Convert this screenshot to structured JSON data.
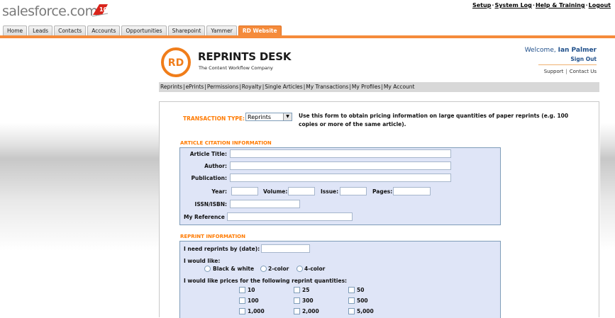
{
  "salesforce": {
    "logo_text": "salesforce.com",
    "logo_badge": "10",
    "top_links": [
      "Setup",
      "System Log",
      "Help & Training",
      "Logout"
    ],
    "tabs": [
      "Home",
      "Leads",
      "Contacts",
      "Accounts",
      "Opportunities",
      "Sharepoint",
      "Yammer",
      "RD Website"
    ],
    "active_tab": "RD Website",
    "accent_color": "#f58b3b"
  },
  "reprints_desk": {
    "logo_initials": "RD",
    "brand_name": "REPRINTS DESK",
    "tagline": "The Content Workflow Company",
    "welcome_prefix": "Welcome,",
    "user_name": "Ian Palmer",
    "sign_out": "Sign Out",
    "support": "Support",
    "contact_us": "Contact Us",
    "nav": [
      "Reprints",
      "ePrints",
      "Permissions",
      "Royalty",
      "Single Articles",
      "My Transactions",
      "My Profiles",
      "My Account"
    ]
  },
  "form": {
    "transaction_type_label": "TRANSACTION TYPE:",
    "transaction_type_value": "Reprints",
    "transaction_note": "Use this form to obtain pricing information on large quantities of paper reprints (e.g. 100 copies or more of the same article).",
    "citation_title": "ARTICLE CITATION INFORMATION",
    "fields": {
      "article_title": "Article Title:",
      "author": "Author:",
      "publication": "Publication:",
      "year": "Year:",
      "volume": "Volume:",
      "issue": "Issue:",
      "pages": "Pages:",
      "issn": "ISSN/ISBN:",
      "my_reference": "My Reference"
    },
    "reprint_title": "REPRINT INFORMATION",
    "need_by_label": "I need reprints by (date):",
    "would_like_label": "I would like:",
    "color_options": [
      "Black & white",
      "2-color",
      "4-color"
    ],
    "quantities_label": "I would like prices for the following reprint quantities:",
    "quantities": [
      "10",
      "25",
      "50",
      "100",
      "300",
      "500",
      "1,000",
      "2,000",
      "5,000"
    ]
  }
}
